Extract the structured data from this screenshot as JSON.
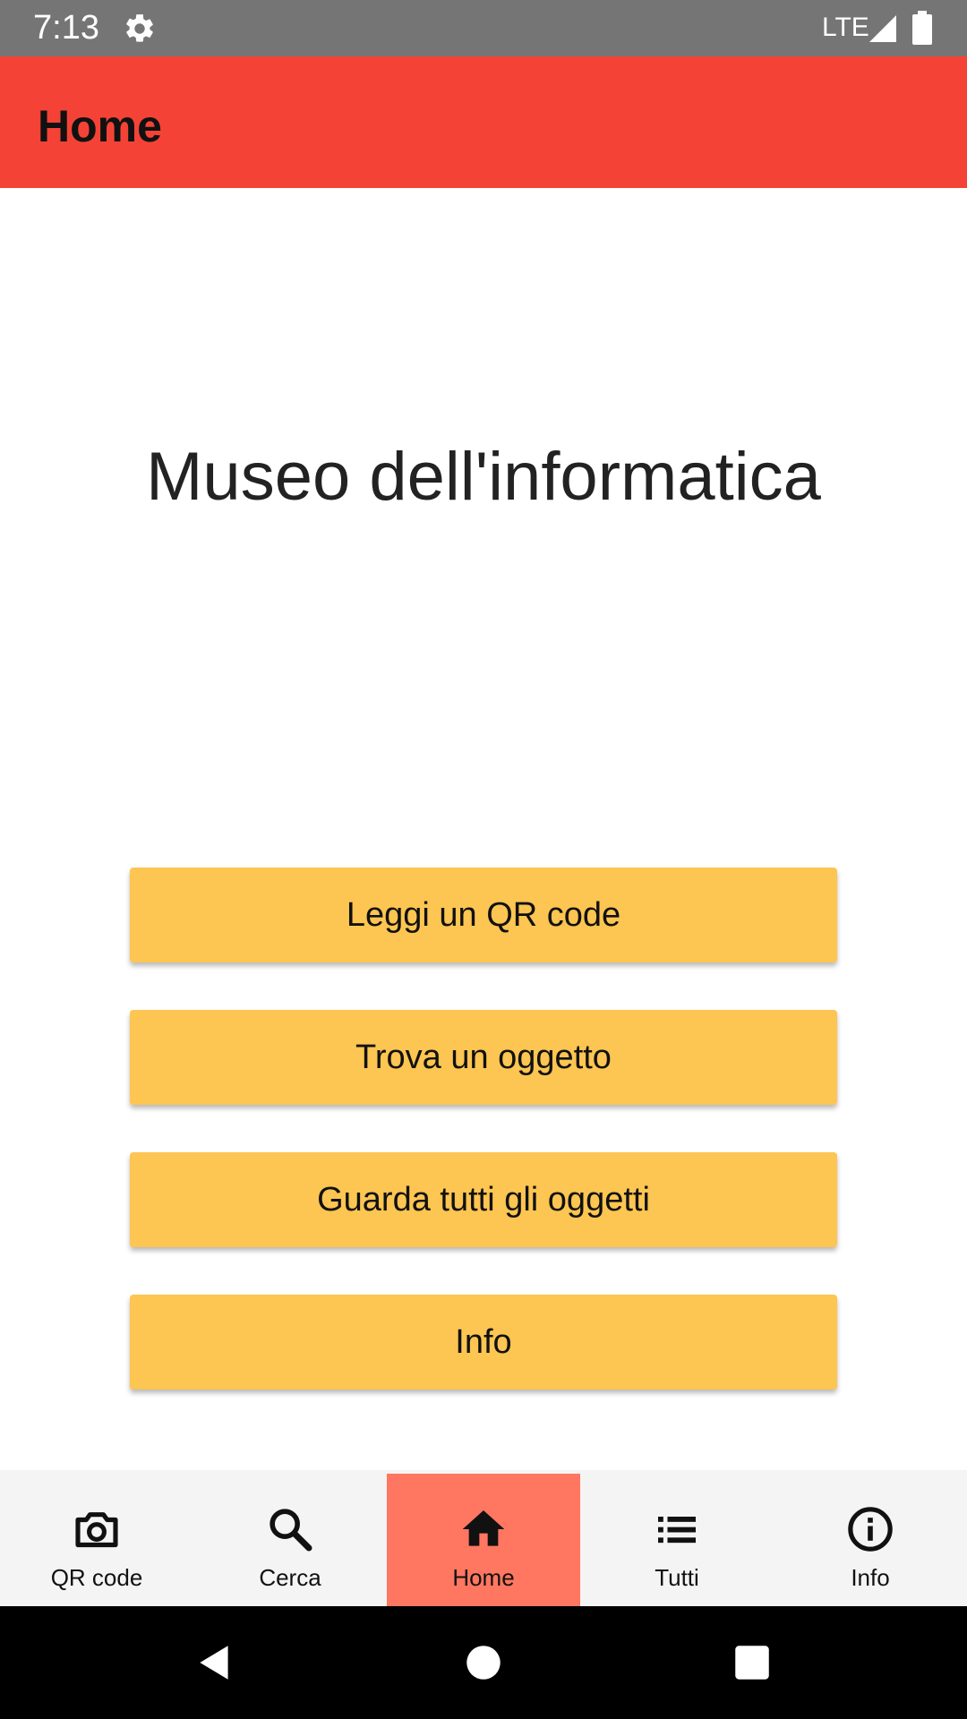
{
  "status_bar": {
    "time": "7:13",
    "network": "LTE",
    "icons": [
      "gear-icon",
      "signal-icon",
      "battery-icon"
    ]
  },
  "app_bar": {
    "title": "Home"
  },
  "main": {
    "title": "Museo dell'informatica",
    "buttons": [
      {
        "label": "Leggi un QR code"
      },
      {
        "label": "Trova un oggetto"
      },
      {
        "label": "Guarda tutti gli oggetti"
      },
      {
        "label": "Info"
      }
    ]
  },
  "bottom_nav": {
    "items": [
      {
        "label": "QR code",
        "icon": "camera-icon"
      },
      {
        "label": "Cerca",
        "icon": "search-icon"
      },
      {
        "label": "Home",
        "icon": "home-icon",
        "active": true
      },
      {
        "label": "Tutti",
        "icon": "list-icon"
      },
      {
        "label": "Info",
        "icon": "info-icon"
      }
    ]
  },
  "system_nav": {
    "icons": [
      "back-icon",
      "home-circle-icon",
      "recents-icon"
    ]
  },
  "colors": {
    "status_bar": "#757575",
    "app_bar": "#f44336",
    "button": "#fdc551",
    "nav_background": "#f4f4f4",
    "nav_active": "#ff7761",
    "system_nav": "#000000"
  }
}
